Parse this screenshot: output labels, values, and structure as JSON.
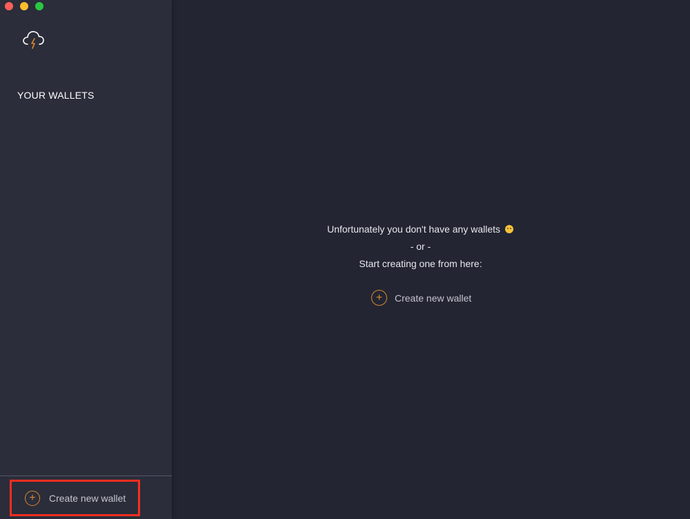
{
  "window": {
    "traffic_lights": [
      "close",
      "minimize",
      "maximize"
    ]
  },
  "sidebar": {
    "logo_icon": "cloud-lightning-icon",
    "heading": "YOUR WALLETS",
    "create_button_label": "Create new wallet"
  },
  "main": {
    "empty_line1": "Unfortunately you don't have any wallets",
    "empty_emoji": "sad-face-emoji",
    "empty_line2": "- or -",
    "empty_line3": "Start creating one from here:",
    "create_button_label": "Create new wallet"
  },
  "colors": {
    "accent": "#d98a2b",
    "highlight_box": "#ff2d20",
    "background": "#232533",
    "sidebar": "#2b2d3a"
  }
}
